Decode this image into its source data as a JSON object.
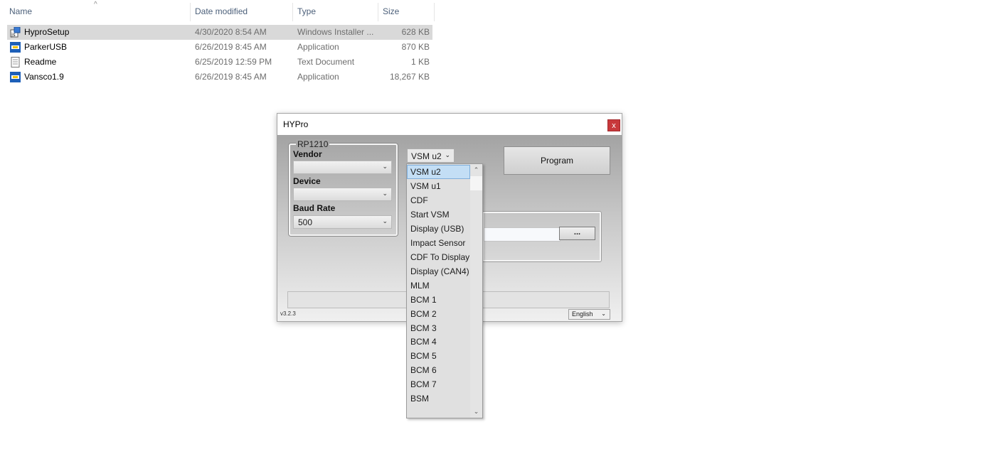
{
  "explorer": {
    "columns": {
      "name": "Name",
      "date": "Date modified",
      "type": "Type",
      "size": "Size"
    },
    "files": [
      {
        "name": "HyproSetup",
        "date": "4/30/2020 8:54 AM",
        "type": "Windows Installer ...",
        "size": "628 KB",
        "icon": "installer-icon",
        "selected": true
      },
      {
        "name": "ParkerUSB",
        "date": "6/26/2019 8:45 AM",
        "type": "Application",
        "size": "870 KB",
        "icon": "application-icon",
        "selected": false
      },
      {
        "name": "Readme",
        "date": "6/25/2019 12:59 PM",
        "type": "Text Document",
        "size": "1 KB",
        "icon": "text-document-icon",
        "selected": false
      },
      {
        "name": "Vansco1.9",
        "date": "6/26/2019 8:45 AM",
        "type": "Application",
        "size": "18,267 KB",
        "icon": "application-icon",
        "selected": false
      }
    ]
  },
  "window": {
    "title": "HYPro",
    "close_label": "x",
    "rp1210": {
      "group_label": "RP1210",
      "vendor_label": "Vendor",
      "vendor_value": "",
      "device_label": "Device",
      "device_value": "",
      "baud_label": "Baud Rate",
      "baud_value": "500"
    },
    "model_select_value": "VSM u2",
    "program_label": "Program",
    "browse_label": "...",
    "version": "v3.2.3",
    "language": "English"
  },
  "dropdown": {
    "selected": "VSM u2",
    "options": [
      "VSM u2",
      "VSM u1",
      "CDF",
      "Start VSM",
      "Display (USB)",
      "Impact Sensor",
      "CDF To Display",
      "Display (CAN4)",
      "MLM",
      "BCM 1",
      "BCM 2",
      "BCM 3",
      "BCM 4",
      "BCM 5",
      "BCM 6",
      "BCM 7",
      "BSM"
    ]
  },
  "colors": {
    "selection_row": "#d9d9d9",
    "close_button": "#c8383b",
    "dropdown_highlight": "#c3def5"
  }
}
